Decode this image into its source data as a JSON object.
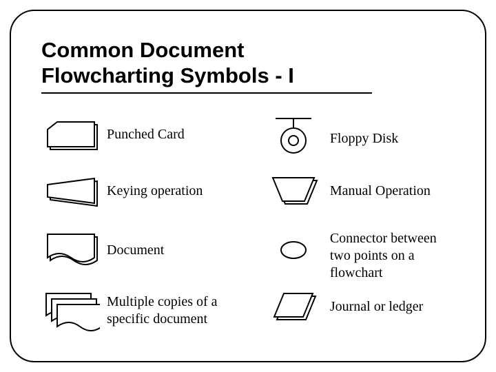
{
  "title": "Common Document\nFlowcharting Symbols - I",
  "symbols": {
    "punched_card": "Punched Card",
    "floppy_disk": "Floppy Disk",
    "keying_operation": "Keying operation",
    "manual_operation": "Manual Operation",
    "document": "Document",
    "connector": "Connector between two points on a flowchart",
    "multiple_copies": "Multiple copies of a specific document",
    "journal": "Journal or ledger"
  }
}
